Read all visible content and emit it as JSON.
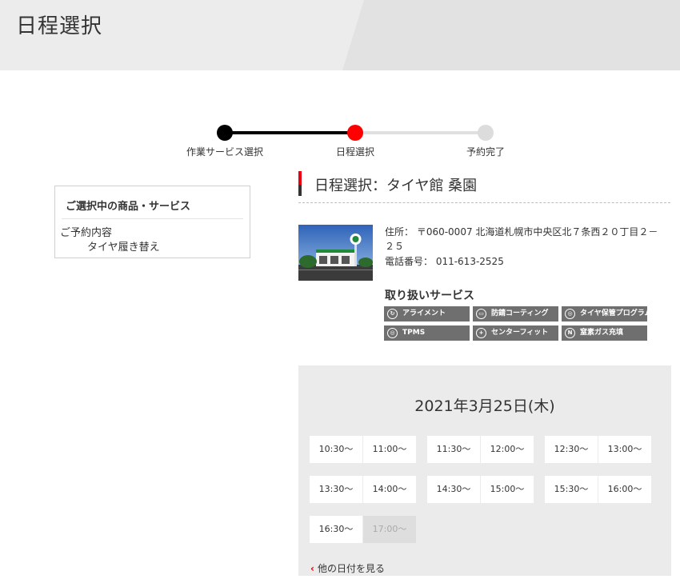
{
  "header": {
    "title": "日程選択"
  },
  "steps": [
    {
      "label": "作業サービス選択",
      "state": "done"
    },
    {
      "label": "日程選択",
      "state": "current"
    },
    {
      "label": "予約完了",
      "state": "todo"
    }
  ],
  "selection": {
    "title": "ご選択中の商品・サービス",
    "subtitle": "ご予約内容",
    "item": "タイヤ履き替え"
  },
  "shop": {
    "title": "日程選択：タイヤ館 桑園",
    "address": "住所： 〒060-0007 北海道札幌市中央区北７条西２０丁目２－２５",
    "tel": "電話番号： 011-613-2525",
    "services_title": "取り扱いサービス",
    "services": [
      {
        "label": "アライメント",
        "icon": "alignment-icon"
      },
      {
        "label": "防錆コーティング",
        "icon": "car-coating-icon"
      },
      {
        "label": "タイヤ保管プログラム",
        "icon": "tire-storage-icon"
      },
      {
        "label": "TPMS",
        "icon": "tpms-icon"
      },
      {
        "label": "センターフィット",
        "icon": "center-fit-icon"
      },
      {
        "label": "窒素ガス充填",
        "icon": "nitrogen-icon"
      }
    ]
  },
  "calendar": {
    "date": "2021年3月25日(木)",
    "slots": [
      {
        "time": "10:30〜",
        "available": true
      },
      {
        "time": "11:00〜",
        "available": true
      },
      {
        "time": "11:30〜",
        "available": true
      },
      {
        "time": "12:00〜",
        "available": true
      },
      {
        "time": "12:30〜",
        "available": true
      },
      {
        "time": "13:00〜",
        "available": true
      },
      {
        "time": "13:30〜",
        "available": true
      },
      {
        "time": "14:00〜",
        "available": true
      },
      {
        "time": "14:30〜",
        "available": true
      },
      {
        "time": "15:00〜",
        "available": true
      },
      {
        "time": "15:30〜",
        "available": true
      },
      {
        "time": "16:00〜",
        "available": true
      },
      {
        "time": "16:30〜",
        "available": true
      },
      {
        "time": "17:00〜",
        "available": false
      }
    ],
    "other_dates_label": "他の日付を見る"
  },
  "colors": {
    "accent": "#e60012",
    "done": "#000000",
    "pending": "#dcdcdc",
    "badge": "#6f6f6f"
  }
}
